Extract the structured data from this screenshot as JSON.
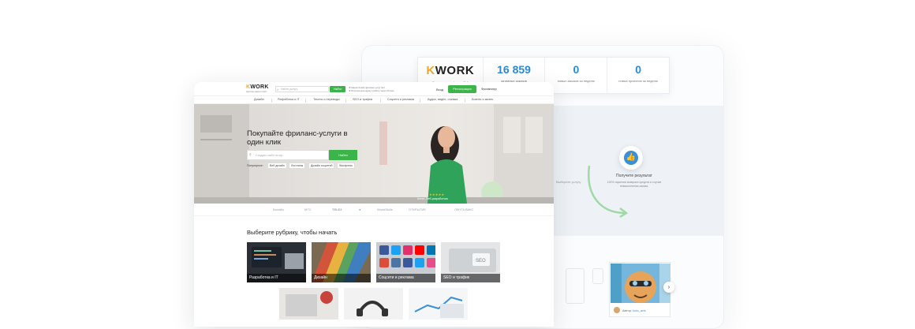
{
  "stats": {
    "logo": "KWORK",
    "logo_caption": "Фриланс платформа №1",
    "items": [
      {
        "value": "16 859",
        "caption": "активных заказов"
      },
      {
        "value": "0",
        "caption": "новых заказов за неделю"
      },
      {
        "value": "0",
        "caption": "новых проектов за неделю"
      }
    ]
  },
  "result_block": {
    "title": "Получите результат",
    "text": "100% гарантия возврата средств в случае невыполнения заказа.",
    "side_text": "Выберите услугу"
  },
  "portfolio": {
    "author_label": "Автор:",
    "author_name": "ludo_arts"
  },
  "header": {
    "logo": "KWORK",
    "logo_sub": "фриланс-маркетплейс",
    "search_placeholder": "Найти услугу",
    "search_button": "Найти",
    "promo_line1": "★ Маркетплейс фриланс-услуг №1",
    "promo_line2": "★ Исполнители начнут работу через 20 мин",
    "login": "Вход",
    "signup": "Регистрация",
    "freelancer": "Фрилансеру"
  },
  "nav": [
    "Дизайн",
    "Разработка и IT",
    "Тексты и переводы",
    "SEO и трафик",
    "Соцсети и реклама",
    "Аудио, видео, съемка",
    "Бизнес и жизнь"
  ],
  "hero": {
    "title": "Покупайте фриланс-услуги в один клик",
    "search_placeholder": "Создать сайт на wp",
    "search_button": "Найти",
    "popular_label": "Популярное:",
    "tags": [
      "Веб дизайн",
      "Логотипы",
      "Дизайн соцсетей",
      "Wordpress"
    ],
    "person": "Ангел, Веб-разработчик",
    "stars": "★★★★★"
  },
  "brands": [
    "Билайн",
    "МТС",
    "TELE2",
    "",
    "WorldSkills",
    "ОТКРЫТИЕ",
    "ЛЕНТА",
    "ВАКС"
  ],
  "section_title": "Выберите рубрику, чтобы начать",
  "categories": [
    "Разработка и IT",
    "Дизайн",
    "Соцсети и реклама",
    "SEO и трафик"
  ]
}
